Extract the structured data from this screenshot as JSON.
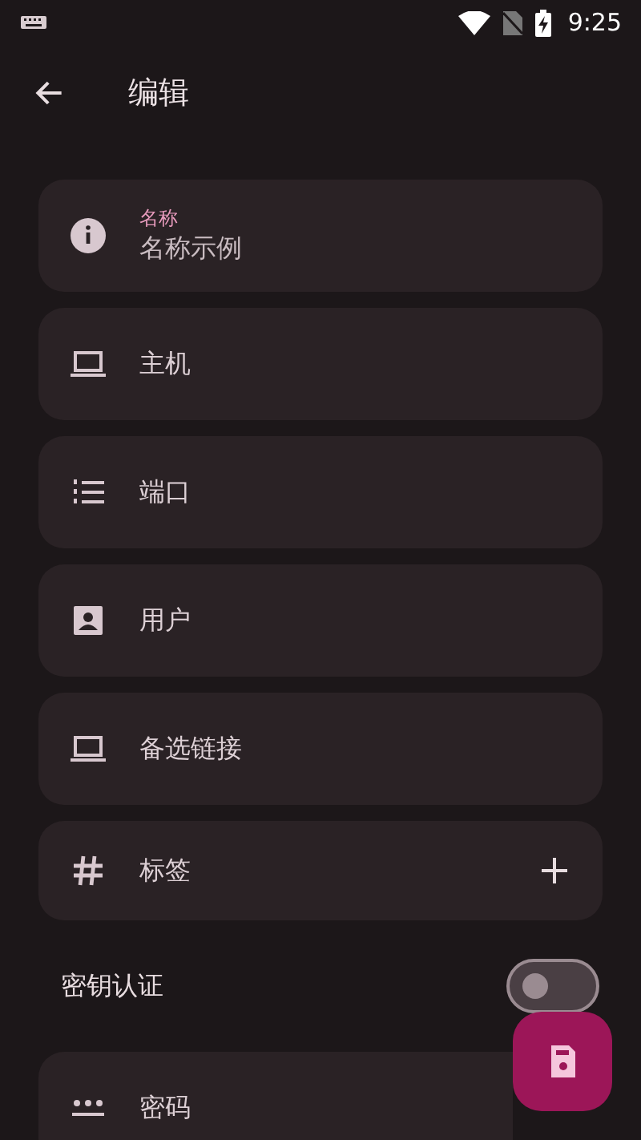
{
  "status_bar": {
    "time": "9:25"
  },
  "toolbar": {
    "title": "编辑"
  },
  "fields": [
    {
      "kind": "filled",
      "label": "名称",
      "value": "名称示例"
    },
    {
      "kind": "text",
      "placeholder": "主机"
    },
    {
      "kind": "text",
      "placeholder": "端口"
    },
    {
      "kind": "text",
      "placeholder": "用户"
    },
    {
      "kind": "text",
      "placeholder": "备选链接"
    },
    {
      "kind": "tags",
      "placeholder": "标签"
    }
  ],
  "key_auth": {
    "label": "密钥认证",
    "on": false
  },
  "password": {
    "placeholder": "密码"
  }
}
